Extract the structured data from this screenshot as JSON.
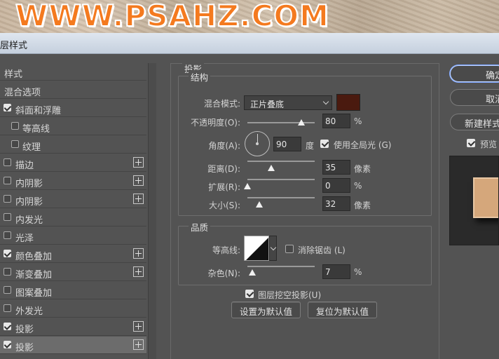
{
  "watermark": {
    "text": "WWW.PSAHZ.COM"
  },
  "window": {
    "title": "层样式"
  },
  "styles_list": {
    "items": [
      {
        "label": "样式",
        "checkbox": null,
        "plus": false,
        "active": false,
        "indent": false
      },
      {
        "label": "混合选项",
        "checkbox": null,
        "plus": false,
        "active": false,
        "indent": false
      },
      {
        "label": "斜面和浮雕",
        "checkbox": true,
        "plus": false,
        "active": false,
        "indent": false
      },
      {
        "label": "等高线",
        "checkbox": false,
        "plus": false,
        "active": false,
        "indent": true
      },
      {
        "label": "纹理",
        "checkbox": false,
        "plus": false,
        "active": false,
        "indent": true
      },
      {
        "label": "描边",
        "checkbox": false,
        "plus": true,
        "active": false,
        "indent": false
      },
      {
        "label": "内阴影",
        "checkbox": false,
        "plus": true,
        "active": false,
        "indent": false
      },
      {
        "label": "内阴影",
        "checkbox": false,
        "plus": true,
        "active": false,
        "indent": false
      },
      {
        "label": "内发光",
        "checkbox": false,
        "plus": false,
        "active": false,
        "indent": false
      },
      {
        "label": "光泽",
        "checkbox": false,
        "plus": false,
        "active": false,
        "indent": false
      },
      {
        "label": "颜色叠加",
        "checkbox": true,
        "plus": true,
        "active": false,
        "indent": false
      },
      {
        "label": "渐变叠加",
        "checkbox": false,
        "plus": true,
        "active": false,
        "indent": false
      },
      {
        "label": "图案叠加",
        "checkbox": false,
        "plus": false,
        "active": false,
        "indent": false
      },
      {
        "label": "外发光",
        "checkbox": false,
        "plus": false,
        "active": false,
        "indent": false
      },
      {
        "label": "投影",
        "checkbox": true,
        "plus": true,
        "active": false,
        "indent": false
      },
      {
        "label": "投影",
        "checkbox": true,
        "plus": true,
        "active": true,
        "indent": false
      }
    ]
  },
  "drop_shadow": {
    "section_title": "投影",
    "structure": {
      "title": "结构",
      "blend_mode_label": "混合模式:",
      "blend_mode_value": "正片叠底",
      "shadow_color": "#4a1a0f",
      "opacity_label": "不透明度(O):",
      "opacity_value": "80",
      "opacity_unit": "%",
      "opacity_fraction": 0.8,
      "angle_label": "角度(A):",
      "angle_value": "90",
      "angle_unit": "度",
      "global_light_label": "使用全局光 (G)",
      "global_light_checked": true,
      "distance_label": "距离(D):",
      "distance_value": "35",
      "distance_unit": "像素",
      "distance_fraction": 0.35,
      "spread_label": "扩展(R):",
      "spread_value": "0",
      "spread_unit": "%",
      "spread_fraction": 0.0,
      "size_label": "大小(S):",
      "size_value": "32",
      "size_unit": "像素",
      "size_fraction": 0.18
    },
    "quality": {
      "title": "品质",
      "contour_label": "等高线:",
      "antialias_label": "消除锯齿 (L)",
      "antialias_checked": false,
      "noise_label": "杂色(N):",
      "noise_value": "7",
      "noise_unit": "%",
      "noise_fraction": 0.07
    },
    "knockout_label": "图层挖空投影(U)",
    "knockout_checked": true,
    "set_default_label": "设置为默认值",
    "reset_default_label": "复位为默认值"
  },
  "side": {
    "ok_label": "确定",
    "cancel_label": "取消",
    "new_style_label": "新建样式...",
    "preview_label": "预览",
    "preview_checked": true,
    "preview_swatch_color": "#d5a77b"
  }
}
